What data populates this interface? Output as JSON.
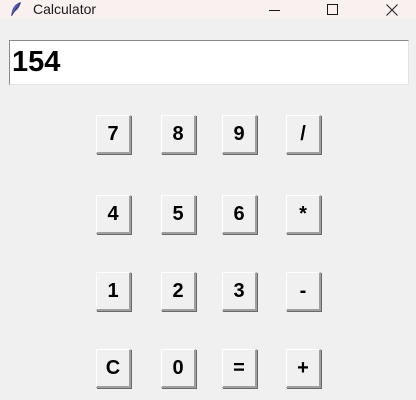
{
  "window": {
    "title": "Calculator",
    "app_icon": "feather-icon",
    "controls": {
      "minimize": "minimize-icon",
      "maximize": "maximize-icon",
      "close": "close-icon"
    }
  },
  "display": {
    "value": "154"
  },
  "keypad": {
    "rows": [
      [
        "7",
        "8",
        "9",
        "/"
      ],
      [
        "4",
        "5",
        "6",
        "*"
      ],
      [
        "1",
        "2",
        "3",
        "-"
      ],
      [
        "C",
        "0",
        "=",
        "+"
      ]
    ]
  }
}
